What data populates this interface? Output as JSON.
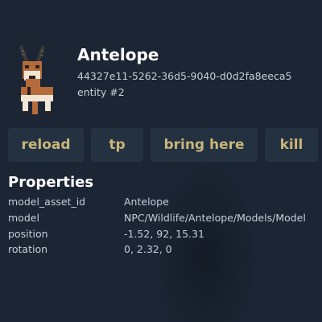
{
  "entity": {
    "name": "Antelope",
    "uuid": "44327e11-5262-36d5-9040-d0d2fa8eeca5",
    "entity_label": "entity #2",
    "avatar_icon": "antelope-icon"
  },
  "actions": {
    "reload": "reload",
    "tp": "tp",
    "bring_here": "bring here",
    "kill": "kill"
  },
  "properties": {
    "title": "Properties",
    "rows": [
      {
        "key": "model_asset_id",
        "value": "Antelope"
      },
      {
        "key": "model",
        "value": "NPC/Wildlife/Antelope/Models/Model"
      },
      {
        "key": "position",
        "value": "-1.52, 92, 15.31"
      },
      {
        "key": "rotation",
        "value": "0, 2.32, 0"
      }
    ]
  },
  "colors": {
    "background": "#1b2533",
    "button_bg": "#243141",
    "button_text": "#c9b679"
  }
}
